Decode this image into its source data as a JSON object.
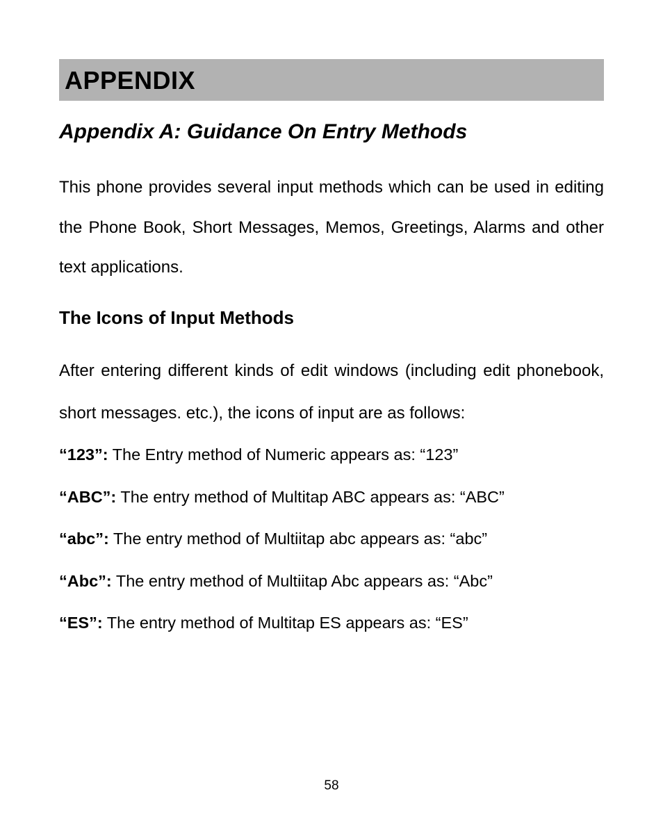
{
  "banner": {
    "title": "APPENDIX"
  },
  "subtitle": "Appendix A: Guidance On Entry Methods",
  "intro": "This phone provides several input methods which can be used in editing the Phone Book, Short Messages, Memos, Greetings, Alarms and other text applications.",
  "section_heading": "The Icons of Input Methods",
  "section_intro": "After entering different kinds of edit windows (including edit phonebook, short messages. etc.), the icons of input are as follows:",
  "items": [
    {
      "label": "“123”:",
      "desc": " The Entry method of Numeric appears as: “123”"
    },
    {
      "label": "“ABC”:",
      "desc": " The entry method of Multitap ABC appears as: “ABC”"
    },
    {
      "label": "“abc”:",
      "desc": " The  entry method of Multiitap abc appears as: “abc”"
    },
    {
      "label": "“Abc”:",
      "desc": " The entry method of Multiitap Abc appears as: “Abc”"
    },
    {
      "label": "“ES”:",
      "desc": " The entry method of Multitap ES appears as: “ES”"
    }
  ],
  "page_number": "58"
}
